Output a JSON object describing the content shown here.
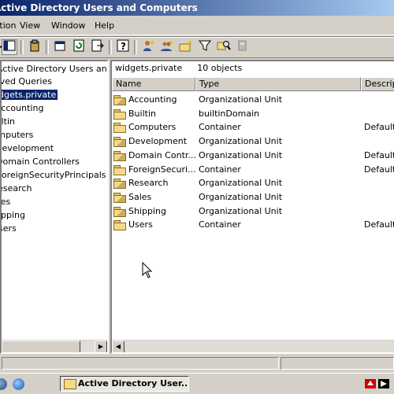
{
  "window": {
    "title": "Active Directory Users and Computers"
  },
  "menu": [
    {
      "label": "Action"
    },
    {
      "label": "View"
    },
    {
      "label": "Window"
    },
    {
      "label": "Help"
    }
  ],
  "toolbar": {
    "buttons": [
      "show-hide-console-tree-icon",
      "properties-icon",
      "copy-icon",
      "refresh-icon",
      "export-list-icon",
      "help-icon",
      "new-user-icon",
      "new-group-icon",
      "new-ou-icon",
      "filter-icon",
      "find-icon",
      "add-to-group-icon"
    ]
  },
  "tree": {
    "items": [
      {
        "label": "Active Directory Users and Computers",
        "selected": false
      },
      {
        "label": "Saved Queries",
        "selected": false
      },
      {
        "label": "widgets.private",
        "selected": true
      },
      {
        "label": "Accounting",
        "selected": false
      },
      {
        "label": "Builtin",
        "selected": false
      },
      {
        "label": "Computers",
        "selected": false
      },
      {
        "label": "Development",
        "selected": false
      },
      {
        "label": "Domain Controllers",
        "selected": false
      },
      {
        "label": "ForeignSecurityPrincipals",
        "selected": false
      },
      {
        "label": "Research",
        "selected": false
      },
      {
        "label": "Sales",
        "selected": false
      },
      {
        "label": "Shipping",
        "selected": false
      },
      {
        "label": "Users",
        "selected": false
      }
    ]
  },
  "list": {
    "header": {
      "domain": "widgets.private",
      "count": "10 objects"
    },
    "columns": [
      "Name",
      "Type",
      "Description"
    ],
    "rows": [
      {
        "name": "Accounting",
        "type": "Organizational Unit",
        "description": "",
        "icon": "ou"
      },
      {
        "name": "Builtin",
        "type": "builtinDomain",
        "description": "",
        "icon": "folder"
      },
      {
        "name": "Computers",
        "type": "Container",
        "description": "Default",
        "icon": "folder"
      },
      {
        "name": "Development",
        "type": "Organizational Unit",
        "description": "",
        "icon": "ou"
      },
      {
        "name": "Domain Contr...",
        "type": "Organizational Unit",
        "description": "Default",
        "icon": "ou"
      },
      {
        "name": "ForeignSecuri...",
        "type": "Container",
        "description": "Default",
        "icon": "folder"
      },
      {
        "name": "Research",
        "type": "Organizational Unit",
        "description": "",
        "icon": "ou"
      },
      {
        "name": "Sales",
        "type": "Organizational Unit",
        "description": "",
        "icon": "ou"
      },
      {
        "name": "Shipping",
        "type": "Organizational Unit",
        "description": "",
        "icon": "ou"
      },
      {
        "name": "Users",
        "type": "Container",
        "description": "Default",
        "icon": "folder"
      }
    ]
  },
  "taskbar": {
    "task_label": "Active Directory User...",
    "quick_launch": [
      "desktop-icon",
      "internet-explorer-icon"
    ]
  },
  "colors": {
    "selection": "#0a246a",
    "chrome": "#d4d0c8",
    "titlebar_start": "#0a246a"
  }
}
